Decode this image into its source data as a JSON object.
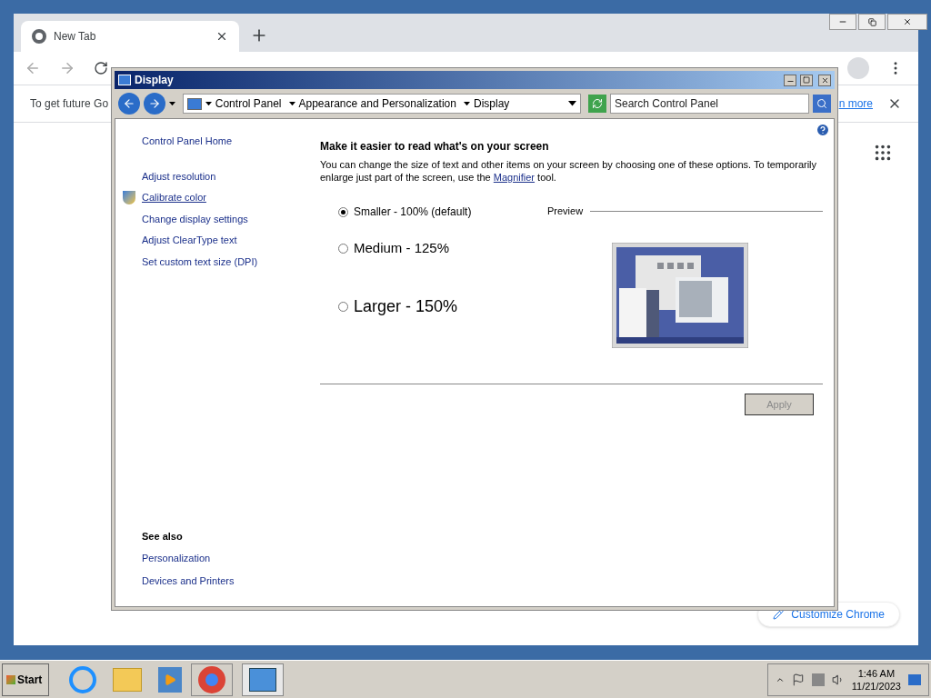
{
  "browser": {
    "tab": {
      "title": "New Tab",
      "selected": true
    },
    "infobar": {
      "text": "To get future Go",
      "link": "n more"
    },
    "customize_button": "Customize Chrome"
  },
  "dialog": {
    "title": "Display",
    "breadcrumb": [
      "Control Panel",
      "Appearance and Personalization",
      "Display"
    ],
    "search": {
      "placeholder": "Search Control Panel"
    },
    "sidebar": {
      "items": [
        {
          "label": "Control Panel Home",
          "kind": "home"
        },
        {
          "label": "Adjust resolution",
          "kind": "link"
        },
        {
          "label": "Calibrate color",
          "kind": "admin"
        },
        {
          "label": "Change display settings",
          "kind": "link"
        },
        {
          "label": "Adjust ClearType text",
          "kind": "link"
        },
        {
          "label": "Set custom text size (DPI)",
          "kind": "link"
        }
      ],
      "see_also": {
        "heading": "See also",
        "links": [
          "Personalization",
          "Devices and Printers"
        ]
      }
    },
    "heading": "Make it easier to read what's on your screen",
    "description": {
      "before": "You can change the size of text and other items on your screen by choosing one of these options. To temporarily enlarge just part of the screen, use the",
      "link": "Magnifier",
      "after": "tool."
    },
    "options": [
      {
        "label": "Smaller - 100% (default)",
        "kind": "small",
        "selected": true
      },
      {
        "label": "Medium - 125%",
        "kind": "medium",
        "selected": false
      },
      {
        "label": "Larger - 150%",
        "kind": "large",
        "selected": false
      }
    ],
    "preview_label": "Preview",
    "apply_button": {
      "label": "Apply",
      "disabled": true
    }
  },
  "taskbar": {
    "start": "Start",
    "time": "1:46 AM",
    "date": "11/21/2023"
  }
}
